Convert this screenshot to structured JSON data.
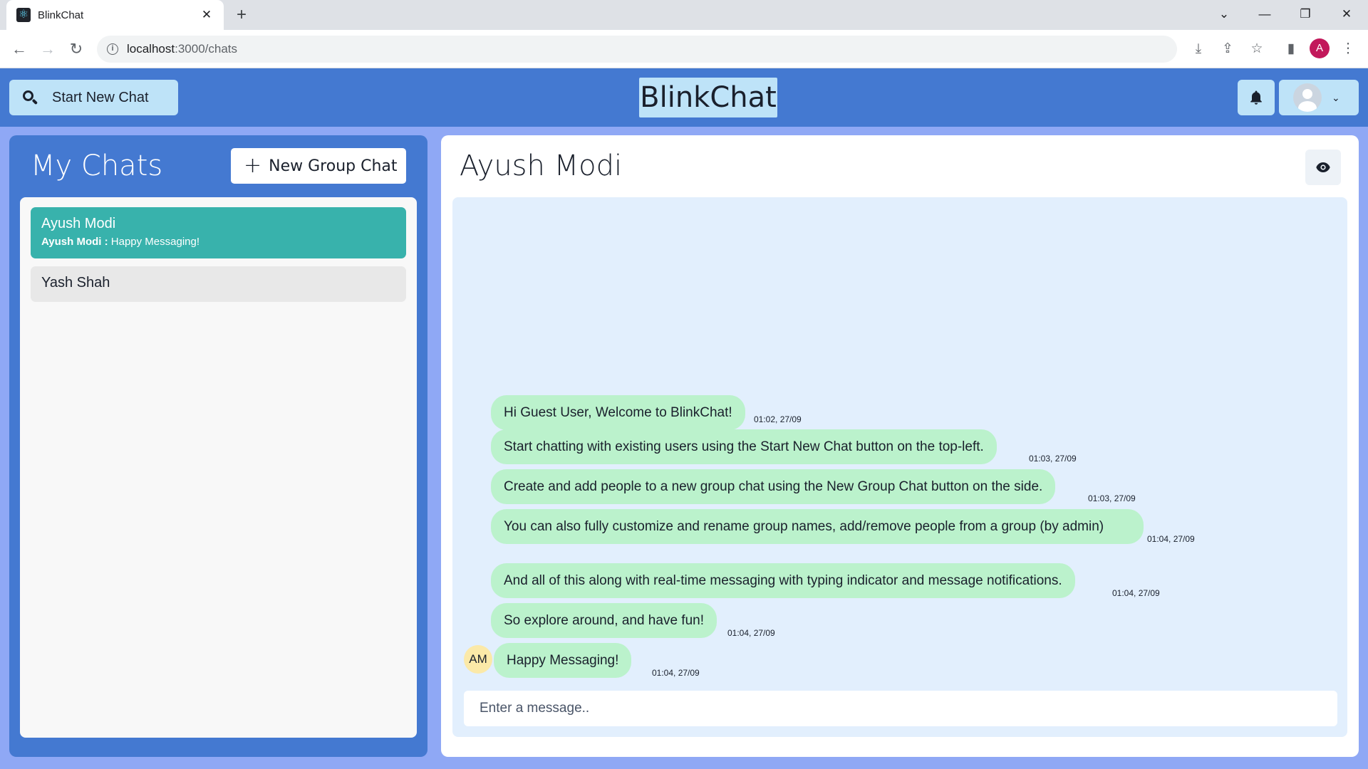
{
  "browser": {
    "tab_title": "BlinkChat",
    "tab_close": "✕",
    "new_tab": "+",
    "url_host": "localhost",
    "url_path": ":3000/chats",
    "profile_initial": "A",
    "window_controls": {
      "tabsearch": "⌄",
      "minimize": "—",
      "restore": "❐",
      "close": "✕"
    }
  },
  "header": {
    "start_new_chat_label": "Start New Chat",
    "brand": "BlinkChat"
  },
  "sidebar": {
    "title": "My Chats",
    "new_group_label": "New Group Chat",
    "chats": [
      {
        "name": "Ayush Modi",
        "preview_sender": "Ayush Modi :",
        "preview_text": " Happy Messaging!",
        "active": true
      },
      {
        "name": "Yash Shah",
        "active": false
      }
    ]
  },
  "chat": {
    "contact_name": "Ayush Modi",
    "sender_initials": "AM",
    "messages": [
      {
        "text": "Hi Guest User, Welcome to BlinkChat!",
        "time": "01:02, 27/09"
      },
      {
        "text": "Start chatting with existing users using the Start New Chat button on the top-left.",
        "time": "01:03, 27/09"
      },
      {
        "text": "Create and add people to a new group chat using the New Group Chat button on the side.",
        "time": "01:03, 27/09"
      },
      {
        "text": "You can also fully customize and rename group names, add/remove people from a group (by admin)",
        "time": "01:04, 27/09"
      },
      {
        "text": "And all of this along with real-time messaging with typing indicator and message notifications.",
        "time": "01:04, 27/09"
      },
      {
        "text": "So explore around, and have fun!",
        "time": "01:04, 27/09"
      },
      {
        "text": "Happy Messaging!",
        "time": "01:04, 27/09"
      }
    ],
    "input_placeholder": "Enter a message.."
  },
  "colors": {
    "header_bg": "#4479d1",
    "page_bg": "#8fa8f5",
    "active_chat": "#38b2ac",
    "bubble": "#bbf2cc",
    "messages_bg": "#e2effd",
    "button_bg": "#bee3f8"
  }
}
